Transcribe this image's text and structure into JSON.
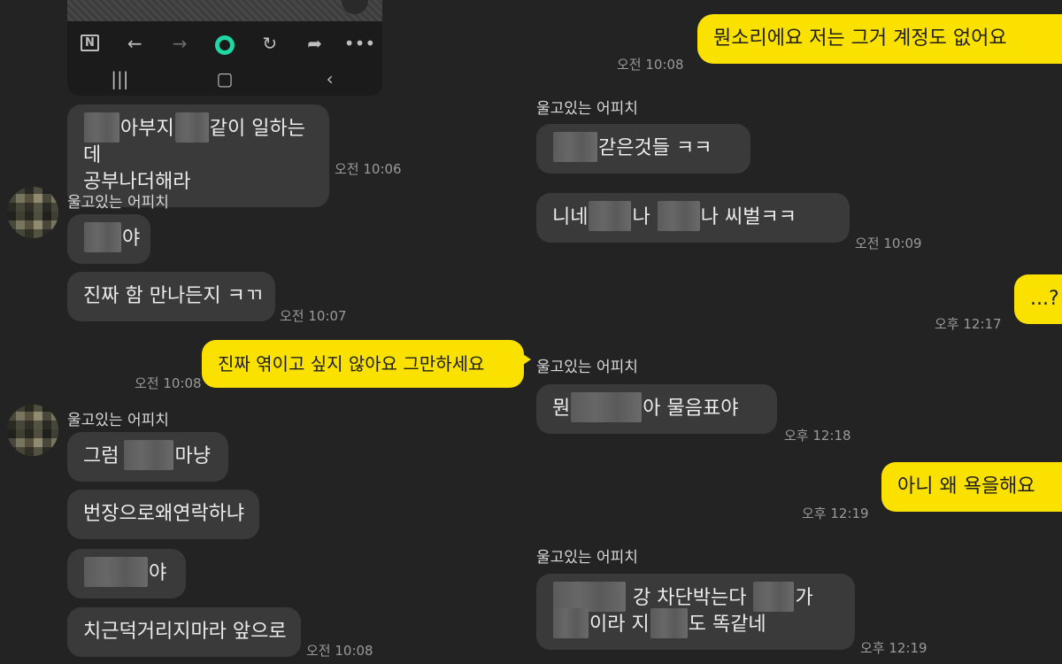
{
  "phone_nav": {
    "top_icons": [
      "n-box-icon",
      "back-arrow-icon",
      "forward-arrow-icon",
      "home-circle-icon",
      "refresh-icon",
      "share-icon",
      "more-dots-icon"
    ],
    "bottom_icons": [
      "recent-apps-icon",
      "home-icon",
      "back-chevron-icon"
    ]
  },
  "left": {
    "m1": {
      "parts": [
        "아부지",
        "같이 일하는데"
      ],
      "line2": "공부나더해라",
      "time": "오전 10:06"
    },
    "sender1": "울고있는 어피치",
    "m2": {
      "after": "야"
    },
    "m3": {
      "text": "진짜 함 만나든지 ㅋㄲ",
      "time": "오전 10:07"
    },
    "me1": {
      "text": "진짜 엮이고 싶지 않아요 그만하세요",
      "time": "오전 10:08"
    },
    "sender2": "울고있는 어피치",
    "m4": {
      "before": "그럼",
      "after": "마냥"
    },
    "m5": {
      "text": "번장으로왜연락하냐"
    },
    "m6": {
      "after": "야"
    },
    "m7": {
      "text": "치근덕거리지마라 앞으로",
      "time": "오전 10:08"
    }
  },
  "right": {
    "me1": {
      "text": "뭔소리에요 저는 그거 계정도 없어요",
      "time": "오전 10:08"
    },
    "sender1": "울고있는 어피치",
    "m1": {
      "after": "갇은것들 ㅋㅋ"
    },
    "m2": {
      "a": "니네",
      "b": "나",
      "c": "나 씨벌ㅋㅋ",
      "time": "오전 10:09"
    },
    "me2": {
      "text": "...?",
      "time": "오후 12:17"
    },
    "sender2": "울고있는 어피치",
    "m3": {
      "a": "뭔",
      "b": "아 물음표야",
      "time": "오후 12:18"
    },
    "me3": {
      "text": "아니 왜 욕을해요",
      "time": "오후 12:19"
    },
    "sender3": "울고있는 어피치",
    "m4": {
      "a": "강 차단박는다",
      "b": "가",
      "c": "이라 지",
      "d": "도 똑같네",
      "time": "오후 12:19"
    }
  }
}
